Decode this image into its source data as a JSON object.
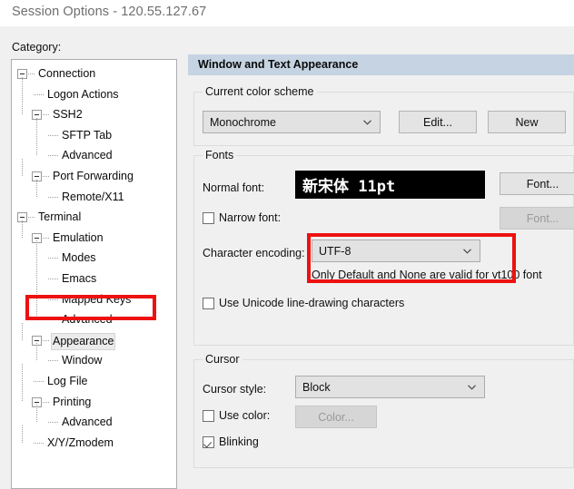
{
  "window": {
    "title": "Session Options - 120.55.127.67"
  },
  "category": {
    "label": "Category:",
    "tree": [
      {
        "label": "Connection",
        "depth": 0,
        "expander": true,
        "selected": false
      },
      {
        "label": "Logon Actions",
        "depth": 1,
        "expander": false,
        "selected": false
      },
      {
        "label": "SSH2",
        "depth": 1,
        "expander": true,
        "selected": false
      },
      {
        "label": "SFTP Tab",
        "depth": 2,
        "expander": false,
        "selected": false
      },
      {
        "label": "Advanced",
        "depth": 2,
        "expander": false,
        "selected": false
      },
      {
        "label": "Port Forwarding",
        "depth": 1,
        "expander": true,
        "selected": false
      },
      {
        "label": "Remote/X11",
        "depth": 2,
        "expander": false,
        "selected": false
      },
      {
        "label": "Terminal",
        "depth": 0,
        "expander": true,
        "selected": false
      },
      {
        "label": "Emulation",
        "depth": 1,
        "expander": true,
        "selected": false
      },
      {
        "label": "Modes",
        "depth": 2,
        "expander": false,
        "selected": false
      },
      {
        "label": "Emacs",
        "depth": 2,
        "expander": false,
        "selected": false
      },
      {
        "label": "Mapped Keys",
        "depth": 2,
        "expander": false,
        "selected": false
      },
      {
        "label": "Advanced",
        "depth": 2,
        "expander": false,
        "selected": false
      },
      {
        "label": "Appearance",
        "depth": 1,
        "expander": true,
        "selected": true
      },
      {
        "label": "Window",
        "depth": 2,
        "expander": false,
        "selected": false
      },
      {
        "label": "Log File",
        "depth": 1,
        "expander": false,
        "selected": false
      },
      {
        "label": "Printing",
        "depth": 1,
        "expander": true,
        "selected": false
      },
      {
        "label": "Advanced",
        "depth": 2,
        "expander": false,
        "selected": false
      },
      {
        "label": "X/Y/Zmodem",
        "depth": 1,
        "expander": false,
        "selected": false
      }
    ]
  },
  "pane": {
    "header": "Window and Text Appearance",
    "color_scheme": {
      "group_title": "Current color scheme",
      "combo_value": "Monochrome",
      "edit_button": "Edit...",
      "new_button": "New"
    },
    "fonts": {
      "group_title": "Fonts",
      "normal_font_label": "Normal font:",
      "normal_font_preview": "新宋体 11pt",
      "normal_font_button": "Font...",
      "narrow_font_label": "Narrow font:",
      "narrow_font_checked": false,
      "narrow_font_button": "Font...",
      "encoding_label": "Character encoding:",
      "encoding_value": "UTF-8",
      "encoding_help": "Only Default and None are valid for vt100 font",
      "unicode_linedraw_label": "Use Unicode line-drawing characters",
      "unicode_linedraw_checked": false
    },
    "cursor": {
      "group_title": "Cursor",
      "style_label": "Cursor style:",
      "style_value": "Block",
      "use_color_label": "Use color:",
      "use_color_checked": false,
      "color_button": "Color...",
      "blinking_label": "Blinking",
      "blinking_checked": true
    }
  },
  "annotations": {
    "highlight_color": "#ee1111",
    "boxes": [
      "appearance-tree-item",
      "character-encoding-row"
    ]
  },
  "colors": {
    "dialog_bg": "#f0f0f0",
    "header_band": "#c5d3e2",
    "tree_bg": "#ffffff",
    "preview_bg": "#000000",
    "preview_fg": "#ffffff"
  }
}
